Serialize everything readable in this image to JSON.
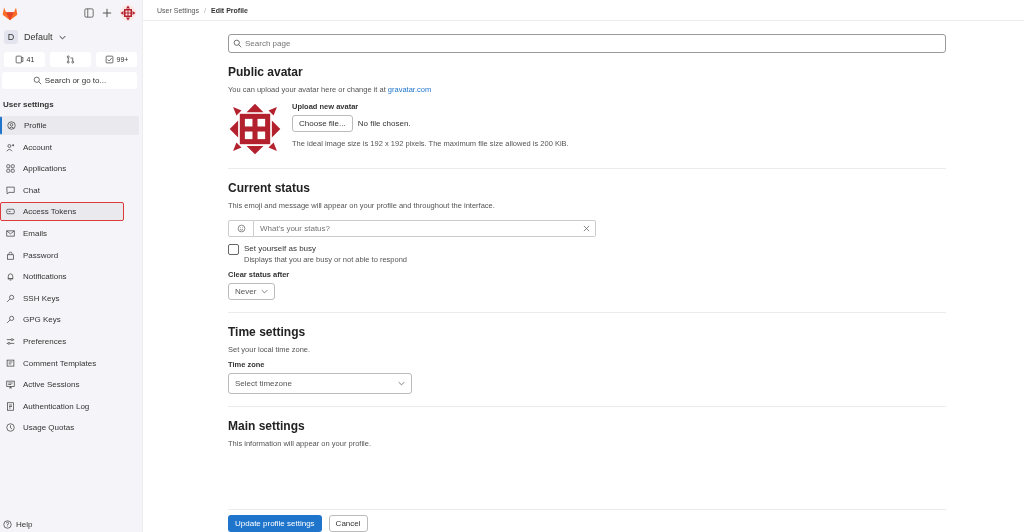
{
  "sidebar": {
    "group": {
      "initial": "D",
      "name": "Default"
    },
    "counters": {
      "issues": "41",
      "todos": "99+"
    },
    "search": {
      "label": "Search or go to..."
    },
    "heading": "User settings",
    "items": [
      {
        "label": "Profile",
        "selected": true,
        "highlighted": false
      },
      {
        "label": "Account",
        "selected": false,
        "highlighted": false
      },
      {
        "label": "Applications",
        "selected": false,
        "highlighted": false
      },
      {
        "label": "Chat",
        "selected": false,
        "highlighted": false
      },
      {
        "label": "Access Tokens",
        "selected": false,
        "highlighted": true
      },
      {
        "label": "Emails",
        "selected": false,
        "highlighted": false
      },
      {
        "label": "Password",
        "selected": false,
        "highlighted": false
      },
      {
        "label": "Notifications",
        "selected": false,
        "highlighted": false
      },
      {
        "label": "SSH Keys",
        "selected": false,
        "highlighted": false
      },
      {
        "label": "GPG Keys",
        "selected": false,
        "highlighted": false
      },
      {
        "label": "Preferences",
        "selected": false,
        "highlighted": false
      },
      {
        "label": "Comment Templates",
        "selected": false,
        "highlighted": false
      },
      {
        "label": "Active Sessions",
        "selected": false,
        "highlighted": false
      },
      {
        "label": "Authentication Log",
        "selected": false,
        "highlighted": false
      },
      {
        "label": "Usage Quotas",
        "selected": false,
        "highlighted": false
      }
    ],
    "help": "Help"
  },
  "breadcrumb": {
    "items": [
      "User Settings",
      "Edit Profile"
    ],
    "separator": "/"
  },
  "search": {
    "placeholder": "Search page"
  },
  "avatar": {
    "title": "Public avatar",
    "desc": "You can upload your avatar here or change it at ",
    "link": "gravatar.com",
    "upload_label": "Upload new avatar",
    "choose": "Choose file...",
    "no_file": "No file chosen.",
    "hint": "The ideal image size is 192 x 192 pixels. The maximum file size allowed is 200 KiB."
  },
  "status": {
    "title": "Current status",
    "desc": "This emoji and message will appear on your profile and throughout the interface.",
    "placeholder": "What's your status?",
    "busy": {
      "label": "Set yourself as busy",
      "help": "Displays that you are busy or not able to respond",
      "checked": false
    },
    "clear_label": "Clear status after",
    "clear_value": "Never"
  },
  "time": {
    "title": "Time settings",
    "desc": "Set your local time zone.",
    "label": "Time zone",
    "value": "Select timezone"
  },
  "main": {
    "title": "Main settings",
    "desc": "This information will appear on your profile."
  },
  "buttons": {
    "primary": "Update profile settings",
    "secondary": "Cancel"
  }
}
